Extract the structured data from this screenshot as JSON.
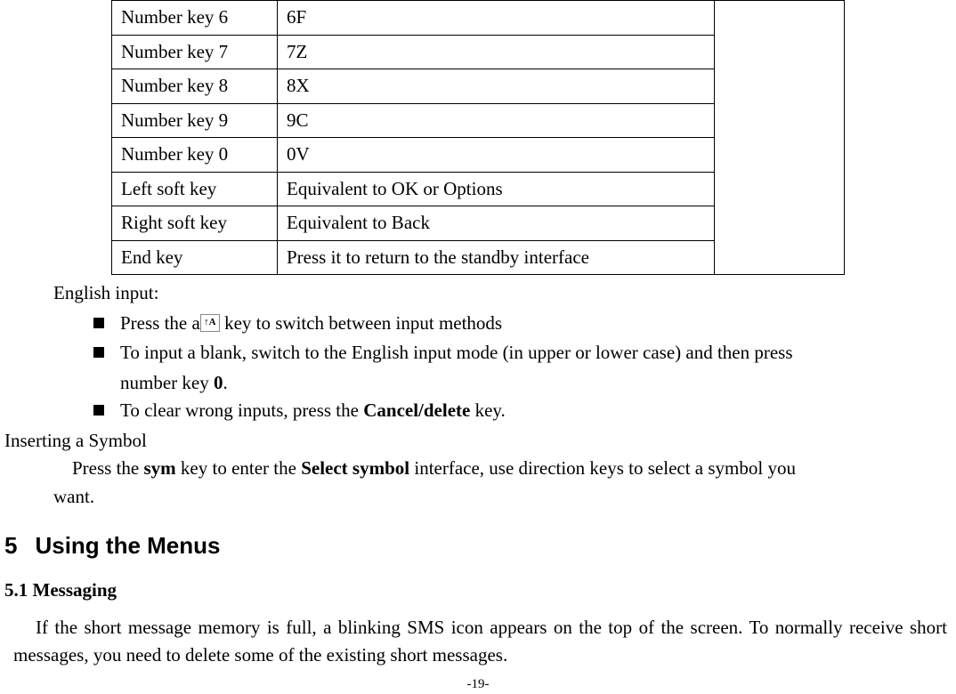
{
  "table": {
    "rows": [
      {
        "key": "Number key 6",
        "val": "6F"
      },
      {
        "key": "Number key 7",
        "val": "7Z"
      },
      {
        "key": "Number key 8",
        "val": "8X"
      },
      {
        "key": "Number key 9",
        "val": "9C"
      },
      {
        "key": "Number key 0",
        "val": "0V"
      },
      {
        "key": "Left soft key",
        "val": "Equivalent to OK or Options"
      },
      {
        "key": "Right soft key",
        "val": "Equivalent to Back"
      },
      {
        "key": "End key",
        "val": "Press it to return to the standby interface"
      }
    ]
  },
  "english_input_label": "English input:",
  "bullets": {
    "b1_pre": "Press the a",
    "icon_text": "↑A",
    "b1_post": "    key to switch between input methods",
    "b2_a": "To input a blank, switch to the English input mode (in upper or lower case) and then press",
    "b2_b_pre": "number key ",
    "b2_b_bold": "0",
    "b2_b_post": ".",
    "b3_pre": "To clear wrong inputs, press the ",
    "b3_bold": "Cancel/delete",
    "b3_post": " key."
  },
  "insert_symbol_heading": "Inserting a Symbol",
  "insert_symbol_body_pre": "Press the ",
  "insert_symbol_b1": "sym",
  "insert_symbol_mid1": " key to enter the ",
  "insert_symbol_b2": "Select symbol",
  "insert_symbol_post": " interface, use direction keys to select a symbol you",
  "insert_symbol_line2": "want.",
  "section5_num": "5",
  "section5_title": "Using the Menus",
  "section51": "5.1 Messaging",
  "messaging_body": "If the short message memory is full, a blinking SMS icon appears on the top of the screen. To normally receive short messages, you need to delete some of the existing short messages.",
  "page_number": "-19-"
}
